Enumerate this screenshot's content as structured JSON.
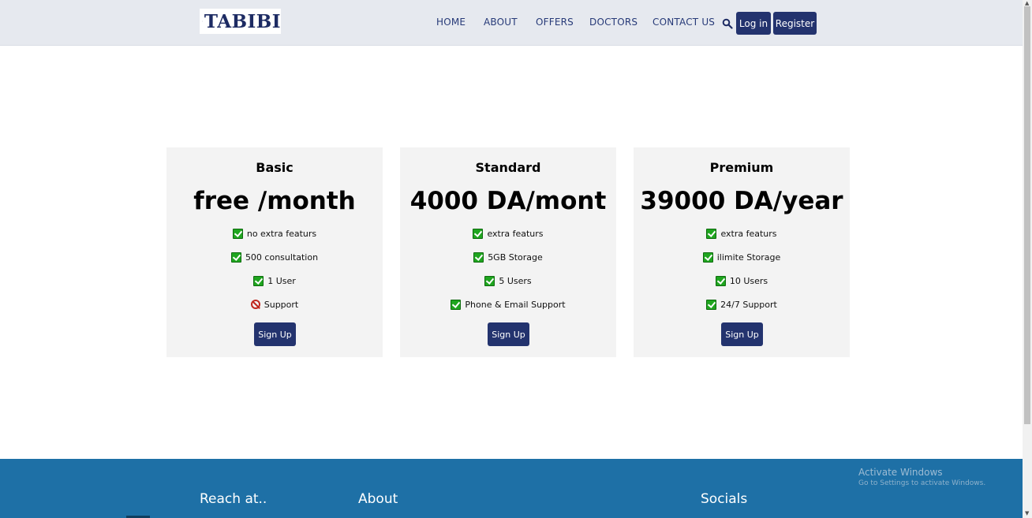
{
  "brand": {
    "name": "TABIBI"
  },
  "nav": {
    "links": [
      "HOME",
      "ABOUT",
      "OFFERS",
      "DOCTORS",
      "CONTACT US"
    ],
    "login_label": "Log in",
    "register_label": "Register"
  },
  "plans": [
    {
      "title": "Basic",
      "price": "free /month",
      "features": [
        {
          "text": "no extra featurs",
          "status": "check"
        },
        {
          "text": "500 consultation",
          "status": "check"
        },
        {
          "text": "1 User",
          "status": "check"
        },
        {
          "text": "Support",
          "status": "prohibited"
        }
      ],
      "cta": "Sign Up"
    },
    {
      "title": "Standard",
      "price": "4000 DA/mont",
      "features": [
        {
          "text": "extra featurs",
          "status": "check"
        },
        {
          "text": "5GB Storage",
          "status": "check"
        },
        {
          "text": "5 Users",
          "status": "check"
        },
        {
          "text": "Phone & Email Support",
          "status": "check"
        }
      ],
      "cta": "Sign Up"
    },
    {
      "title": "Premium",
      "price": "39000 DA/year",
      "features": [
        {
          "text": "extra featurs",
          "status": "check"
        },
        {
          "text": "ilimite Storage",
          "status": "check"
        },
        {
          "text": "10 Users",
          "status": "check"
        },
        {
          "text": "24/7 Support",
          "status": "check"
        }
      ],
      "cta": "Sign Up"
    }
  ],
  "footer": {
    "headings": [
      "Reach at..",
      "About",
      "Socials"
    ]
  },
  "watermark": {
    "title": "Activate Windows",
    "subtitle": "Go to Settings to activate Windows."
  },
  "colors": {
    "navbar_bg": "#e6e9ef",
    "brand_navy": "#23336e",
    "card_bg": "#f3f3f3",
    "footer_bg": "#1e70a6",
    "check_green": "#1fa51f",
    "prohibit_red": "#c0281f"
  },
  "icons": {
    "logo": "stethoscope-icon",
    "search": "search-icon",
    "included": "checkmark-icon",
    "excluded": "prohibited-icon"
  }
}
